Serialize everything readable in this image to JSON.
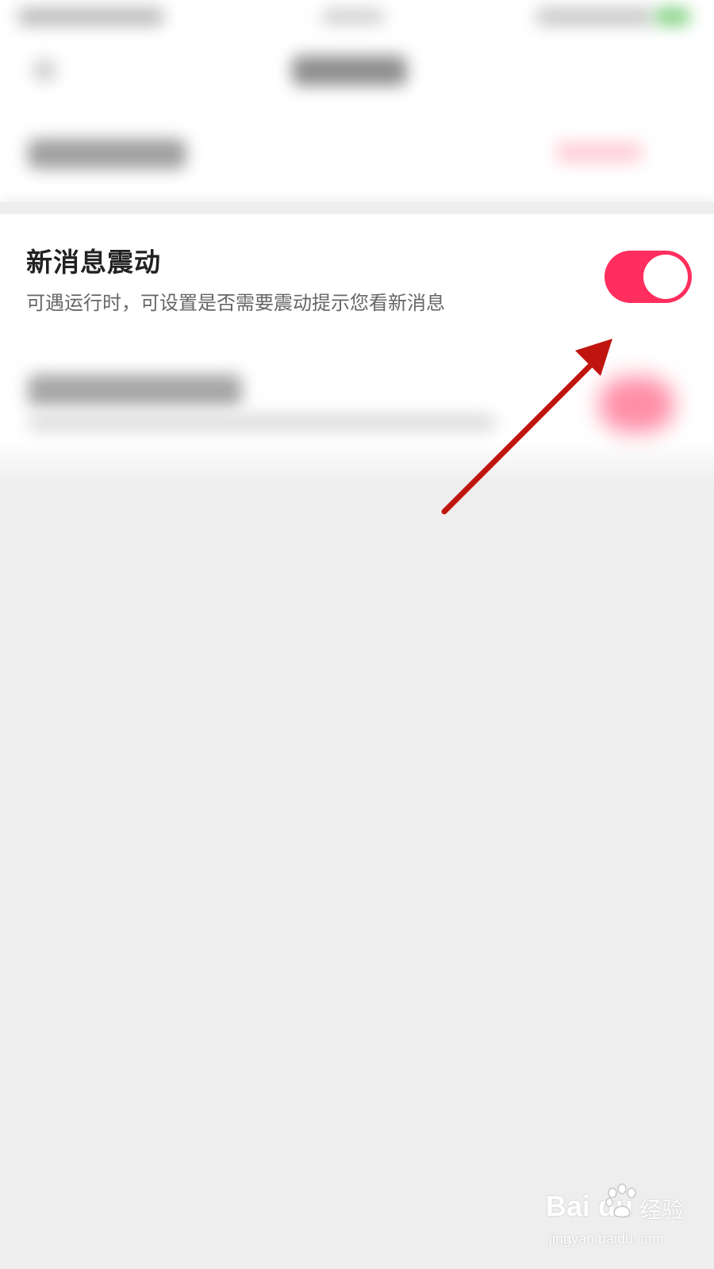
{
  "setting": {
    "title": "新消息震动",
    "description": "可遇运行时，可设置是否需要震动提示您看新消息",
    "toggle_on": true
  },
  "colors": {
    "toggle_on": "#ff2e5e",
    "arrow": "#c0150f",
    "background": "#eeeeee"
  },
  "watermark": {
    "brand": "Bai   du",
    "chinese": "经验",
    "domain": "jingyan.baidu.com",
    "icon": "paw-icon"
  },
  "annotation": {
    "icon": "arrow-icon"
  }
}
